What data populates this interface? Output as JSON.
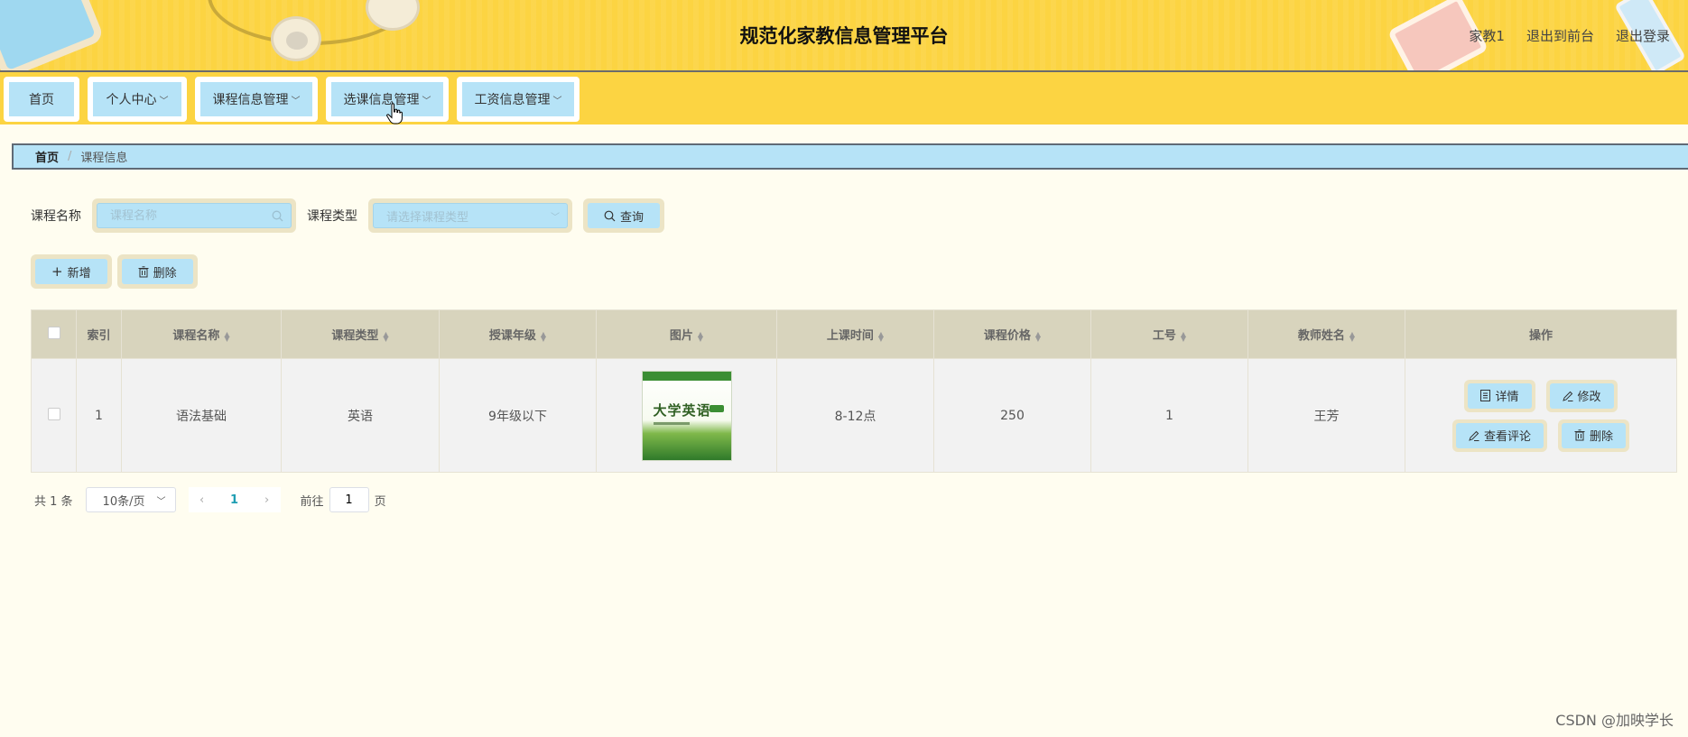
{
  "header": {
    "title": "规范化家教信息管理平台",
    "user": "家教1",
    "back_to_front": "退出到前台",
    "logout": "退出登录"
  },
  "nav": {
    "items": [
      {
        "label": "首页",
        "has_dropdown": false
      },
      {
        "label": "个人中心",
        "has_dropdown": true
      },
      {
        "label": "课程信息管理",
        "has_dropdown": true
      },
      {
        "label": "选课信息管理",
        "has_dropdown": true
      },
      {
        "label": "工资信息管理",
        "has_dropdown": true
      }
    ]
  },
  "breadcrumb": {
    "home": "首页",
    "separator": "/",
    "current": "课程信息"
  },
  "search": {
    "name_label": "课程名称",
    "name_placeholder": "课程名称",
    "type_label": "课程类型",
    "type_placeholder": "请选择课程类型",
    "query_button": "查询"
  },
  "actions": {
    "add": "新增",
    "delete": "删除"
  },
  "table": {
    "columns": [
      "索引",
      "课程名称",
      "课程类型",
      "授课年级",
      "图片",
      "上课时间",
      "课程价格",
      "工号",
      "教师姓名",
      "操作"
    ],
    "rows": [
      {
        "index": "1",
        "course_name": "语法基础",
        "course_type": "英语",
        "grade": "9年级以下",
        "image_title": "大学英语",
        "time": "8-12点",
        "price": "250",
        "staff_no": "1",
        "teacher": "王芳",
        "ops": {
          "detail": "详情",
          "edit": "修改",
          "comments": "查看评论",
          "delete": "删除"
        }
      }
    ]
  },
  "pagination": {
    "total": "共 1 条",
    "page_size": "10条/页",
    "current_page": "1",
    "goto_label": "前往",
    "goto_value": "1",
    "page_suffix": "页"
  },
  "watermark": "CSDN @加映学长",
  "colors": {
    "header_bg": "#fcd442",
    "button_bg": "#b6e3f7",
    "table_header_bg": "#d8d4bd",
    "page_bg": "#fffdf0"
  }
}
